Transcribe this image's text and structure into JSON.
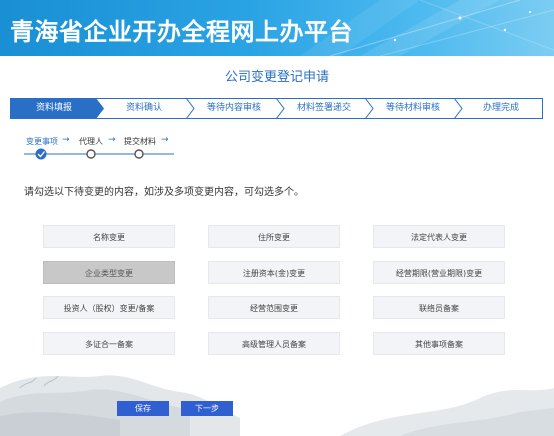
{
  "banner": {
    "title": "青海省企业开办全程网上办平台"
  },
  "page": {
    "title": "公司变更登记申请"
  },
  "steps": [
    "资料填报",
    "资料确认",
    "等待内容审核",
    "材料签署递交",
    "等待材料审核",
    "办理完成"
  ],
  "substeps": [
    {
      "label": "变更事项",
      "state": "active"
    },
    {
      "label": "代理人",
      "state": "pending"
    },
    {
      "label": "提交材料",
      "state": "pending"
    }
  ],
  "instruction": "请勾选以下待变更的内容，如涉及多项变更内容，可勾选多个。",
  "options": [
    {
      "label": "名称变更",
      "selected": false
    },
    {
      "label": "住所变更",
      "selected": false
    },
    {
      "label": "法定代表人变更",
      "selected": false
    },
    {
      "label": "企业类型变更",
      "selected": true
    },
    {
      "label": "注册资本(金)变更",
      "selected": false
    },
    {
      "label": "经营期限(营业期限)变更",
      "selected": false
    },
    {
      "label": "投资人（股权）变更/备案",
      "selected": false
    },
    {
      "label": "经营范围变更",
      "selected": false
    },
    {
      "label": "联络员备案",
      "selected": false
    },
    {
      "label": "多证合一备案",
      "selected": false
    },
    {
      "label": "高级管理人员备案",
      "selected": false
    },
    {
      "label": "其他事项备案",
      "selected": false
    }
  ],
  "buttons": {
    "save": "保存",
    "next": "下一步"
  },
  "colors": {
    "accent": "#2a6fc6",
    "button": "#2f5fd0",
    "banner": "#1a8fd4"
  }
}
